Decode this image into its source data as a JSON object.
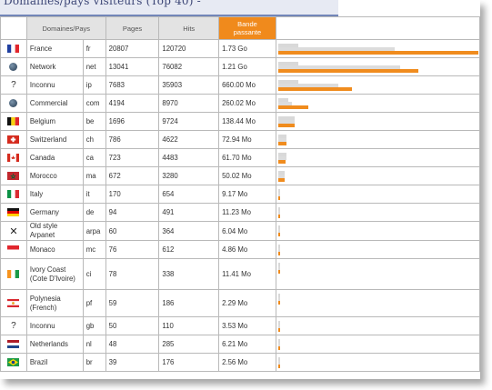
{
  "title": "Domaines/pays visiteurs (Top 40) -",
  "headers": {
    "domain": "Domaines/Pays",
    "pages": "Pages",
    "hits": "Hits",
    "bandwidth_1": "Bande",
    "bandwidth_2": "passante"
  },
  "colors": {
    "bandwidth_header": "#f08a1c",
    "bandwidth_bar": "#f08c1e",
    "traffic_bar": "#d9d9d9"
  },
  "rows": [
    {
      "flag": "flag-fr",
      "name": "France",
      "code": "fr",
      "pages": "20807",
      "hits": "120720",
      "bandwidth": "1.73 Go",
      "p": 0.1,
      "h": 0.58,
      "b": 1.0
    },
    {
      "flag": "globe",
      "name": "Network",
      "code": "net",
      "pages": "13041",
      "hits": "76082",
      "bandwidth": "1.21 Go",
      "p": 0.1,
      "h": 0.61,
      "b": 0.7
    },
    {
      "flag": "unknown",
      "name": "Inconnu",
      "code": "ip",
      "pages": "7683",
      "hits": "35903",
      "bandwidth": "660.00 Mo",
      "p": 0.1,
      "h": 0.3,
      "b": 0.37
    },
    {
      "flag": "globe",
      "name": "Commercial",
      "code": "com",
      "pages": "4194",
      "hits": "8970",
      "bandwidth": "260.02 Mo",
      "p": 0.05,
      "h": 0.07,
      "b": 0.15
    },
    {
      "flag": "flag-be",
      "name": "Belgium",
      "code": "be",
      "pages": "1696",
      "hits": "9724",
      "bandwidth": "138.44 Mo",
      "p": 0.08,
      "h": 0.08,
      "b": 0.08
    },
    {
      "flag": "flag-ch",
      "name": "Switzerland",
      "code": "ch",
      "pages": "786",
      "hits": "4622",
      "bandwidth": "72.94 Mo",
      "p": 0.04,
      "h": 0.04,
      "b": 0.04
    },
    {
      "flag": "flag-ca",
      "name": "Canada",
      "code": "ca",
      "pages": "723",
      "hits": "4483",
      "bandwidth": "61.70 Mo",
      "p": 0.04,
      "h": 0.04,
      "b": 0.035
    },
    {
      "flag": "flag-ma",
      "name": "Morocco",
      "code": "ma",
      "pages": "672",
      "hits": "3280",
      "bandwidth": "50.02 Mo",
      "p": 0.03,
      "h": 0.03,
      "b": 0.03
    },
    {
      "flag": "flag-it",
      "name": "Italy",
      "code": "it",
      "pages": "170",
      "hits": "654",
      "bandwidth": "9.17 Mo",
      "p": 0.01,
      "h": 0.01,
      "b": 0.008
    },
    {
      "flag": "flag-de",
      "name": "Germany",
      "code": "de",
      "pages": "94",
      "hits": "491",
      "bandwidth": "11.23 Mo",
      "p": 0.008,
      "h": 0.008,
      "b": 0.008
    },
    {
      "flag": "cross",
      "name": "Old style Arpanet",
      "code": "arpa",
      "pages": "60",
      "hits": "364",
      "bandwidth": "6.04 Mo",
      "p": 0.006,
      "h": 0.006,
      "b": 0.006
    },
    {
      "flag": "flag-mc",
      "name": "Monaco",
      "code": "mc",
      "pages": "76",
      "hits": "612",
      "bandwidth": "4.86 Mo",
      "p": 0.006,
      "h": 0.006,
      "b": 0.006
    },
    {
      "flag": "flag-ci",
      "name": "Ivory Coast (Cote D'Ivoire)",
      "code": "ci",
      "pages": "78",
      "hits": "338",
      "bandwidth": "11.41 Mo",
      "p": 0.006,
      "h": 0.006,
      "b": 0.008
    },
    {
      "flag": "flag-pf",
      "name": "Polynesia (French)",
      "code": "pf",
      "pages": "59",
      "hits": "186",
      "bandwidth": "2.29 Mo",
      "p": 0.005,
      "h": 0.005,
      "b": 0.005
    },
    {
      "flag": "unknown",
      "name": "Inconnu",
      "code": "gb",
      "pages": "50",
      "hits": "110",
      "bandwidth": "3.53 Mo",
      "p": 0.005,
      "h": 0.005,
      "b": 0.005
    },
    {
      "flag": "flag-nl",
      "name": "Netherlands",
      "code": "nl",
      "pages": "48",
      "hits": "285",
      "bandwidth": "6.21 Mo",
      "p": 0.005,
      "h": 0.005,
      "b": 0.006
    },
    {
      "flag": "flag-br",
      "name": "Brazil",
      "code": "br",
      "pages": "39",
      "hits": "176",
      "bandwidth": "2.56 Mo",
      "p": 0.005,
      "h": 0.005,
      "b": 0.005
    }
  ]
}
